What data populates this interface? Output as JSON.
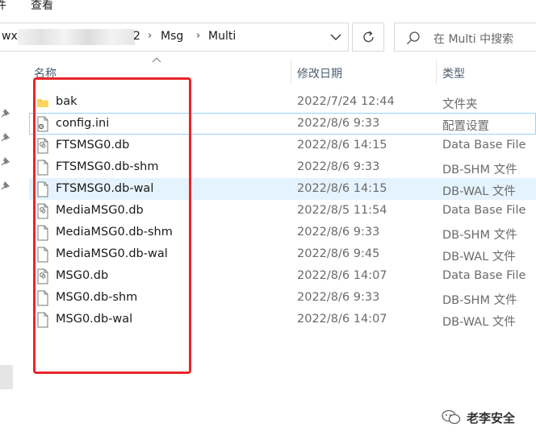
{
  "ribbon": {
    "menu": [
      "件",
      "查看"
    ]
  },
  "address": {
    "crumbs": [
      "wx",
      "2",
      "Msg",
      "Multi"
    ],
    "separator": "›"
  },
  "search": {
    "placeholder": "在 Multi 中搜索"
  },
  "columns": {
    "name": "名称",
    "modified": "修改日期",
    "type": "类型"
  },
  "files": [
    {
      "name": "bak",
      "modified": "2022/7/24 12:44",
      "type": "文件夹",
      "icon": "folder-icon"
    },
    {
      "name": "config.ini",
      "modified": "2022/8/6 9:33",
      "type": "配置设置",
      "icon": "config-file-icon"
    },
    {
      "name": "FTSMSG0.db",
      "modified": "2022/8/6 14:15",
      "type": "Data Base File",
      "icon": "database-file-icon"
    },
    {
      "name": "FTSMSG0.db-shm",
      "modified": "2022/8/6 9:33",
      "type": "DB-SHM 文件",
      "icon": "file-icon"
    },
    {
      "name": "FTSMSG0.db-wal",
      "modified": "2022/8/6 14:15",
      "type": "DB-WAL 文件",
      "icon": "file-icon"
    },
    {
      "name": "MediaMSG0.db",
      "modified": "2022/8/5 11:54",
      "type": "Data Base File",
      "icon": "database-file-icon"
    },
    {
      "name": "MediaMSG0.db-shm",
      "modified": "2022/8/6 9:33",
      "type": "DB-SHM 文件",
      "icon": "file-icon"
    },
    {
      "name": "MediaMSG0.db-wal",
      "modified": "2022/8/6 9:45",
      "type": "DB-WAL 文件",
      "icon": "file-icon"
    },
    {
      "name": "MSG0.db",
      "modified": "2022/8/6 14:07",
      "type": "Data Base File",
      "icon": "database-file-icon"
    },
    {
      "name": "MSG0.db-shm",
      "modified": "2022/8/6 9:33",
      "type": "DB-SHM 文件",
      "icon": "file-icon"
    },
    {
      "name": "MSG0.db-wal",
      "modified": "2022/8/6 14:07",
      "type": "DB-WAL 文件",
      "icon": "file-icon"
    }
  ],
  "watermark": {
    "text": "老李安全"
  },
  "colors": {
    "annotation": "#e8262a",
    "hover": "#e5f3ff",
    "focus": "#99d1ff",
    "folder": "#f8c94b"
  }
}
